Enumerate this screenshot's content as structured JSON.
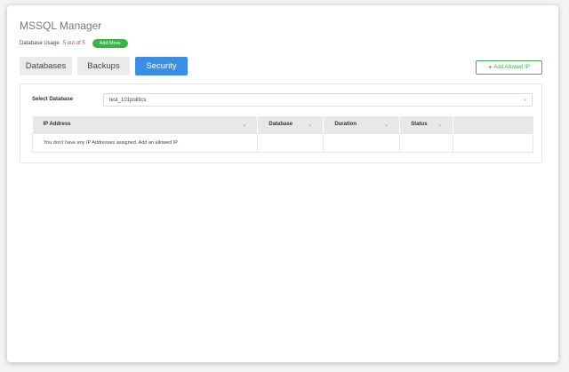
{
  "app": {
    "title": "MSSQL Manager"
  },
  "usage": {
    "label": "Database Usage",
    "count": "5 out of 5",
    "add_more_label": "Add More"
  },
  "tabs": [
    {
      "label": "Databases",
      "active": false
    },
    {
      "label": "Backups",
      "active": false
    },
    {
      "label": "Security",
      "active": true
    }
  ],
  "toolbar": {
    "add_ip_label": "Add Allowed IP"
  },
  "security": {
    "select_label": "Select Database",
    "selected_database": "test_101politics",
    "table": {
      "columns": [
        "IP Address",
        "Database",
        "Duration",
        "Status"
      ],
      "empty_message": "You don't have any IP Addresses assigned. Add an allowed IP."
    }
  },
  "colors": {
    "accent": "#3a8ee6",
    "success": "#3cb34a",
    "danger": "#e53935"
  },
  "icons": {
    "plus": "plus-icon",
    "chevron": "chevron-down-icon"
  }
}
